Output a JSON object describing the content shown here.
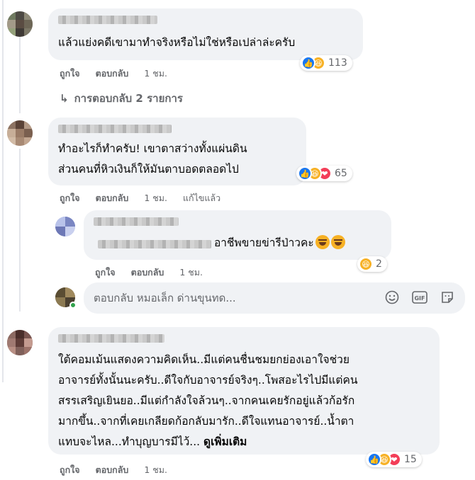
{
  "comments": [
    {
      "text": "แล้วแย่งคดีเขามาทำจริงหรือไม่ใช่หรือเปล่าล่ะครับ",
      "actions": {
        "like": "ถูกใจ",
        "reply": "ตอบกลับ",
        "time": "1 ชม."
      },
      "reaction_count": "113",
      "reaction_icons": [
        "like-icon",
        "haha-icon"
      ]
    },
    {
      "text": "ทำอะไรก็ทำครับ! เขาตาสว่างทั้งแผ่นดิน\nส่วนคนที่หิวเงินก็ให้มันตาบอดตลอดไป",
      "actions": {
        "like": "ถูกใจ",
        "reply": "ตอบกลับ",
        "time": "1 ชม.",
        "edited": "แก้ไขแล้ว"
      },
      "reaction_count": "65",
      "reaction_icons": [
        "like-icon",
        "haha-icon",
        "love-icon"
      ]
    },
    {
      "text": "ใต้คอมเม้นแสดงความคิดเห็น..มีแต่คนชื่นชมยกย่องเอาใจช่วย\nอาจารย์ทั้งนั้นนะครับ..ดีใจกับอาจารย์จริงๆ..โพสอะไรไปมีแต่คน\nสรรเสริญเยินยอ..มีแต่กำลังใจล้วนๆ..จากคนเคยรักอยู่แล้วก้อรัก\nมากขึ้น..จากที่เคยเกลียดก้อกลับมารัก..ดีใจแทนอาจารย์..น้ำตา\nแทบจะไหล...ทำบุญบารมีไว้... ",
      "see_more": "ดูเพิ่มเติม",
      "actions": {
        "like": "ถูกใจ",
        "reply": "ตอบกลับ",
        "time": "1 ชม."
      },
      "reaction_count": "15",
      "reaction_icons": [
        "like-icon",
        "haha-icon",
        "love-icon"
      ]
    }
  ],
  "view_replies": "การตอบกลับ 2 รายการ",
  "nested_reply": {
    "text": "อาชีพขายข่ารีป่าวคะ",
    "actions": {
      "like": "ถูกใจ",
      "reply": "ตอบกลับ",
      "time": "1 ชม."
    },
    "reaction_count": "2",
    "reaction_icons": [
      "haha-icon"
    ]
  },
  "reply_box": {
    "placeholder": "ตอบกลับ หมอเล็ก ด่านขุนทด...",
    "icons": [
      "emoji-icon",
      "gif-icon",
      "sticker-icon"
    ]
  },
  "colors": {
    "bubble": "#f0f2f5",
    "secondary_text": "#65676b",
    "like": "#1877f2",
    "haha": "#f7b125",
    "love": "#f33e58"
  }
}
